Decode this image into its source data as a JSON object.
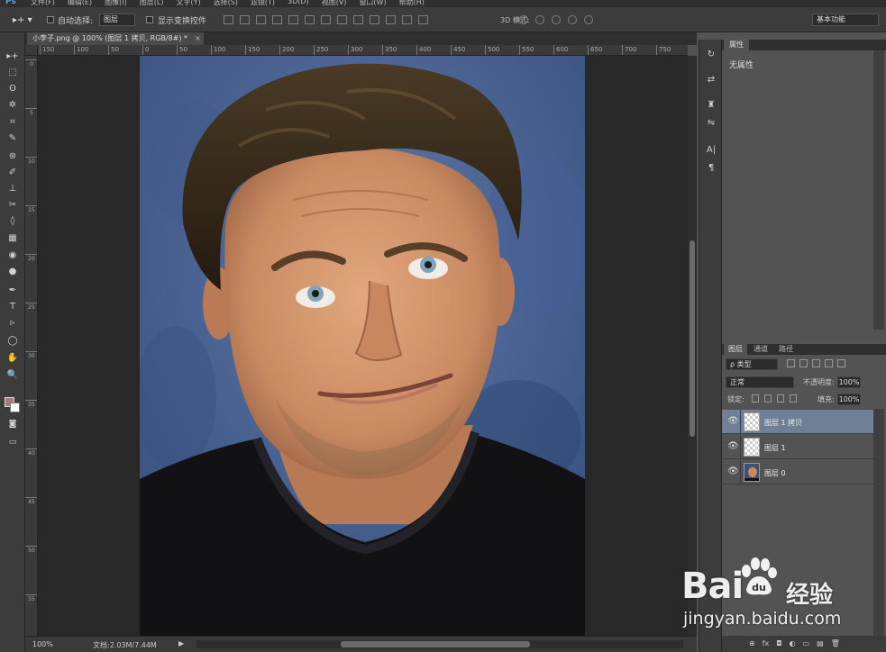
{
  "menubar": {
    "logo": "Ps",
    "items": [
      "文件(F)",
      "编辑(E)",
      "图像(I)",
      "图层(L)",
      "文字(Y)",
      "选择(S)",
      "滤镜(T)",
      "3D(D)",
      "视图(V)",
      "窗口(W)",
      "帮助(H)"
    ]
  },
  "options": {
    "tool_glyph": "▸+ ▾",
    "auto_select_label": "自动选择:",
    "auto_select_value": "图层",
    "transform_label": "显示变换控件",
    "mode_3d_label": "3D 模式:",
    "workspace": "基本功能"
  },
  "document": {
    "tab_title": "小李子.png @ 100% (图层 1 拷贝, RGB/8#) *",
    "close_glyph": "×",
    "ruler_h_ticks": [
      "150",
      "100",
      "50",
      "0",
      "50",
      "100",
      "150",
      "200",
      "250",
      "300",
      "350",
      "400",
      "450",
      "500",
      "550",
      "600",
      "650",
      "700",
      "750"
    ],
    "ruler_v_ticks": [
      "0",
      "5",
      "10",
      "15",
      "20",
      "25",
      "30",
      "35",
      "40",
      "45",
      "50",
      "55"
    ]
  },
  "status": {
    "zoom": "100%",
    "doc_size": "文档:2.03M/7.44M",
    "arrow": "▶"
  },
  "properties": {
    "tab": "属性",
    "empty_text": "无属性"
  },
  "layers_panel": {
    "tabs": [
      "图层",
      "通道",
      "路径"
    ],
    "filter_label": "ρ 类型",
    "blend_mode": "正常",
    "opacity_label": "不透明度:",
    "opacity_value": "100%",
    "lock_label": "锁定:",
    "fill_label": "填充:",
    "fill_value": "100%",
    "layers": [
      {
        "name": "图层 1 拷贝",
        "selected": true
      },
      {
        "name": "图层 1",
        "selected": false
      },
      {
        "name": "图层 0",
        "selected": false
      }
    ],
    "footer_icons": [
      "⊕",
      "fx",
      "◘",
      "◐",
      "▭",
      "▤",
      "🗑"
    ]
  },
  "watermark": {
    "brand_left": "Bai",
    "brand_right": "经验",
    "url": "jingyan.baidu.com"
  },
  "tools": [
    "▸+",
    "⬚",
    "ʘ",
    "✲",
    "⌗",
    "✎",
    "⊛",
    "✐",
    "⊥",
    "✂",
    "◊",
    "▦",
    "◉",
    "●",
    "✒",
    "T",
    "▹",
    "◯",
    "✋",
    "🔍"
  ],
  "dock_icons": [
    "↻",
    "⇄",
    "♜",
    "⇋",
    "A|",
    "¶"
  ]
}
